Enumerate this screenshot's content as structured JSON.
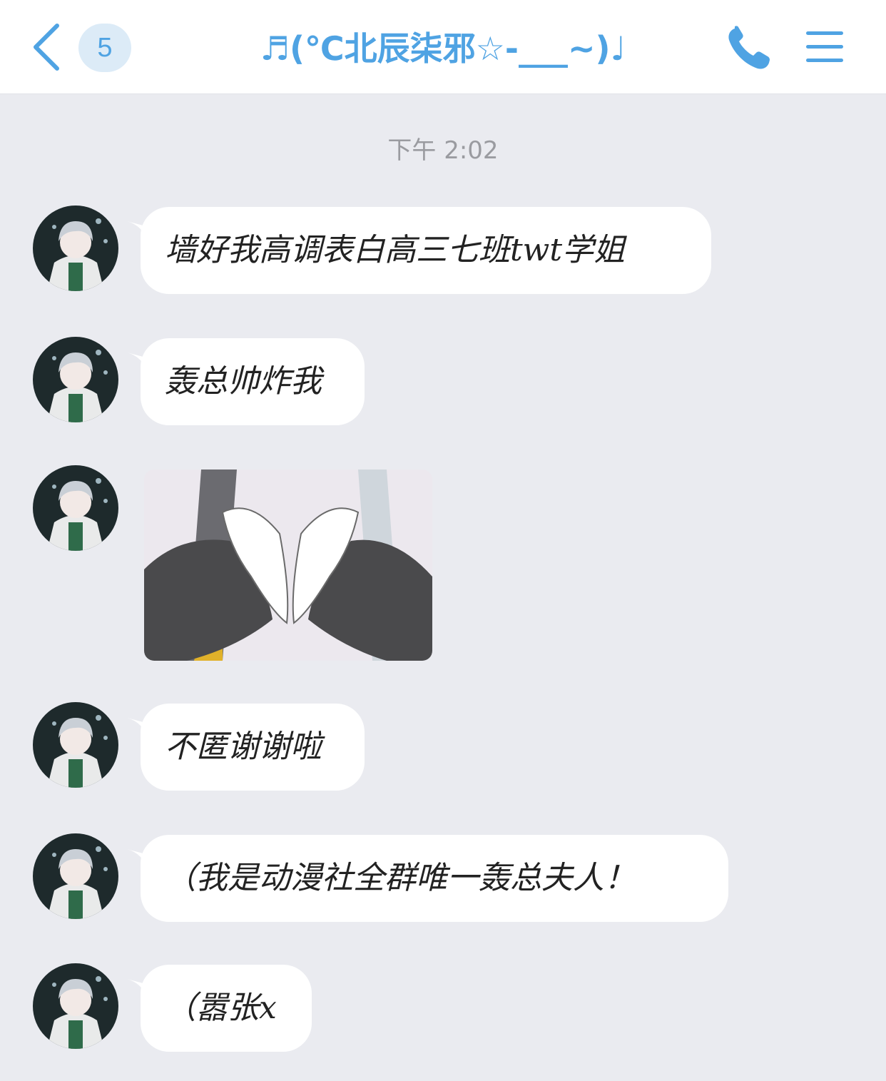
{
  "header": {
    "unread_count": "5",
    "title": "♬(℃北辰柒邪☆-___~)♩",
    "back_icon": "chevron-left-icon",
    "call_icon": "phone-icon",
    "menu_icon": "hamburger-menu-icon",
    "accent_color": "#4fa3e3"
  },
  "chat": {
    "timestamp": "下午 2:02",
    "messages": [
      {
        "type": "text",
        "text": "墙好我高调表白高三七班twt学姐"
      },
      {
        "type": "text",
        "text": "轰总帅炸我"
      },
      {
        "type": "sticker",
        "description": "heart-hands-sticker"
      },
      {
        "type": "text",
        "text": "不匿谢谢啦"
      },
      {
        "type": "text",
        "text": "（我是动漫社全群唯一轰总夫人！"
      },
      {
        "type": "text",
        "text": "（嚣张x"
      }
    ]
  }
}
